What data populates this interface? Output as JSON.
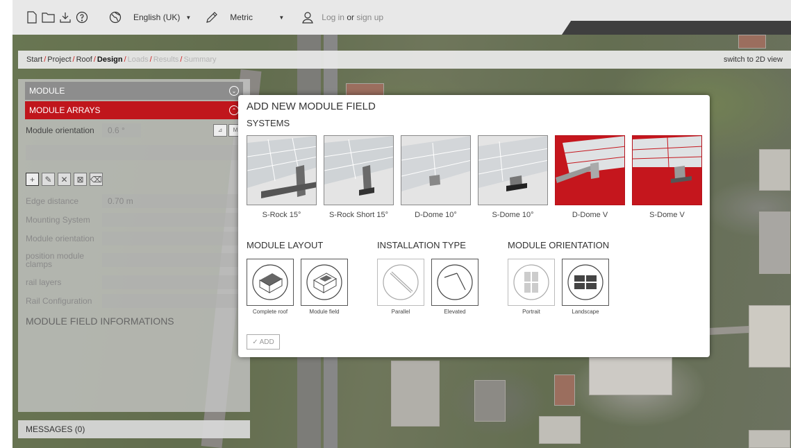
{
  "toolbar": {
    "language": "English (UK)",
    "units": "Metric",
    "login_text": "Log in",
    "or_text": "or",
    "signup_text": "sign up"
  },
  "breadcrumb": {
    "items": [
      "Start",
      "Project",
      "Roof",
      "Design",
      "Loads",
      "Results",
      "Summary"
    ],
    "active": "Design",
    "switch_view": "switch to 2D view"
  },
  "panel": {
    "module_header": "MODULE",
    "arrays_header": "MODULE ARRAYS",
    "module_orientation_label": "Module orientation",
    "module_orientation_value": "0.6 °",
    "edge_distance_label": "Edge distance",
    "edge_distance_value": "0.70 m",
    "mounting_system_label": "Mounting System",
    "module_orientation2_label": "Module orientation",
    "position_clamps_label": "position module clamps",
    "rail_layers_label": "rail layers",
    "rail_config_label": "Rail Configuration",
    "field_info_title": "MODULE FIELD INFORMATIONS",
    "messages": "MESSAGES (0)"
  },
  "modal": {
    "title": "ADD NEW MODULE FIELD",
    "systems_title": "SYSTEMS",
    "systems": [
      {
        "label": "S-Rock 15°",
        "selected": false
      },
      {
        "label": "S-Rock Short 15°",
        "selected": false
      },
      {
        "label": "D-Dome 10°",
        "selected": false
      },
      {
        "label": "S-Dome 10°",
        "selected": false
      },
      {
        "label": "D-Dome V",
        "selected": true
      },
      {
        "label": "S-Dome V",
        "selected": true
      }
    ],
    "layout_title": "MODULE LAYOUT",
    "layout_options": [
      "Complete roof",
      "Module field"
    ],
    "installation_title": "INSTALLATION TYPE",
    "installation_options": [
      "Parallel",
      "Elevated"
    ],
    "orientation_title": "MODULE ORIENTATION",
    "orientation_options": [
      "Portrait",
      "Landscape"
    ],
    "add_label": "ADD"
  },
  "colors": {
    "accent_red": "#c0161c",
    "panel_gray": "#c8c8c8"
  }
}
